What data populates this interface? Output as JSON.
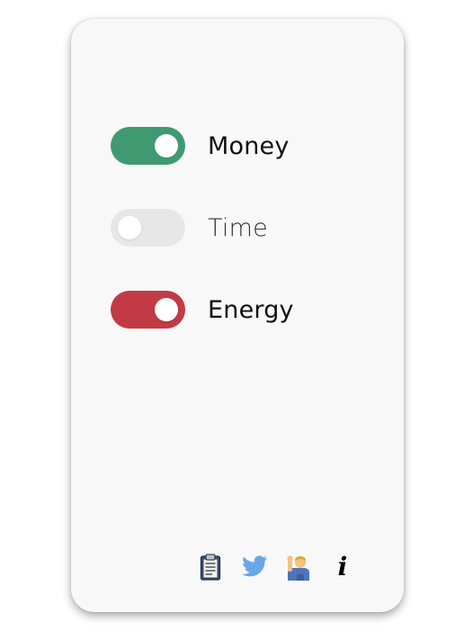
{
  "toggles": [
    {
      "label": "Money",
      "state": "on",
      "color": "#3f9a72"
    },
    {
      "label": "Time",
      "state": "off",
      "color": "#e7e7e7"
    },
    {
      "label": "Energy",
      "state": "on",
      "color": "#c23a45"
    }
  ],
  "footer": {
    "icons": [
      "clipboard-icon",
      "twitter-bird-icon",
      "person-raising-hand-icon",
      "info-icon"
    ],
    "info_glyph": "i"
  },
  "colors": {
    "card_background": "#f8f8f8",
    "knob": "#ffffff",
    "twitter_blue": "#6aa7e8"
  }
}
